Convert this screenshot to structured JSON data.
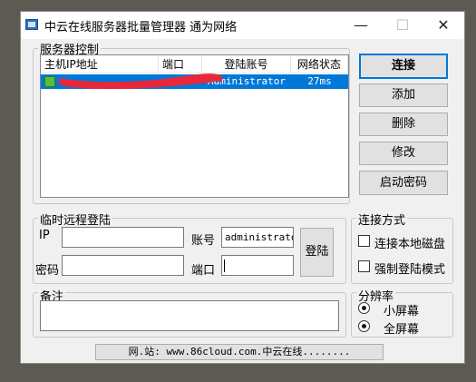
{
  "window": {
    "title": "中云在线服务器批量管理器 通为网络"
  },
  "title_buttons": {
    "minimize": "—",
    "maximize": "☐",
    "close": "✕"
  },
  "server_control": {
    "group_label": "服务器控制",
    "columns": [
      "主机IP地址",
      "端口",
      "登陆账号",
      "网络状态"
    ],
    "rows": [
      {
        "ip": "",
        "port": "",
        "account": "Administrator",
        "status": "27ms",
        "selected": true
      }
    ]
  },
  "side_buttons": {
    "connect": "连接",
    "add": "添加",
    "delete": "删除",
    "modify": "修改",
    "boot_password": "启动密码"
  },
  "temp_login": {
    "group_label": "临时远程登陆",
    "ip_label": "IP",
    "ip_value": "",
    "account_label": "账号",
    "account_value": "administrator",
    "password_label": "密码",
    "password_value": "",
    "port_label": "端口",
    "port_value": "",
    "login_button": "登陆"
  },
  "connect_mode": {
    "group_label": "连接方式",
    "options": [
      {
        "label": "连接本地磁盘",
        "checked": false
      },
      {
        "label": "强制登陆模式",
        "checked": false
      }
    ]
  },
  "remarks": {
    "group_label": "备注",
    "value": ""
  },
  "resolution": {
    "group_label": "分辨率",
    "options": [
      {
        "label": "小屏幕",
        "selected": true
      },
      {
        "label": "全屏幕",
        "selected": true
      }
    ]
  },
  "status_bar": {
    "text": "网.站: www.86cloud.com.中云在线........"
  },
  "colors": {
    "selection": "#0078d7",
    "redaction": "#e8283a",
    "online": "#5bbd3c"
  }
}
